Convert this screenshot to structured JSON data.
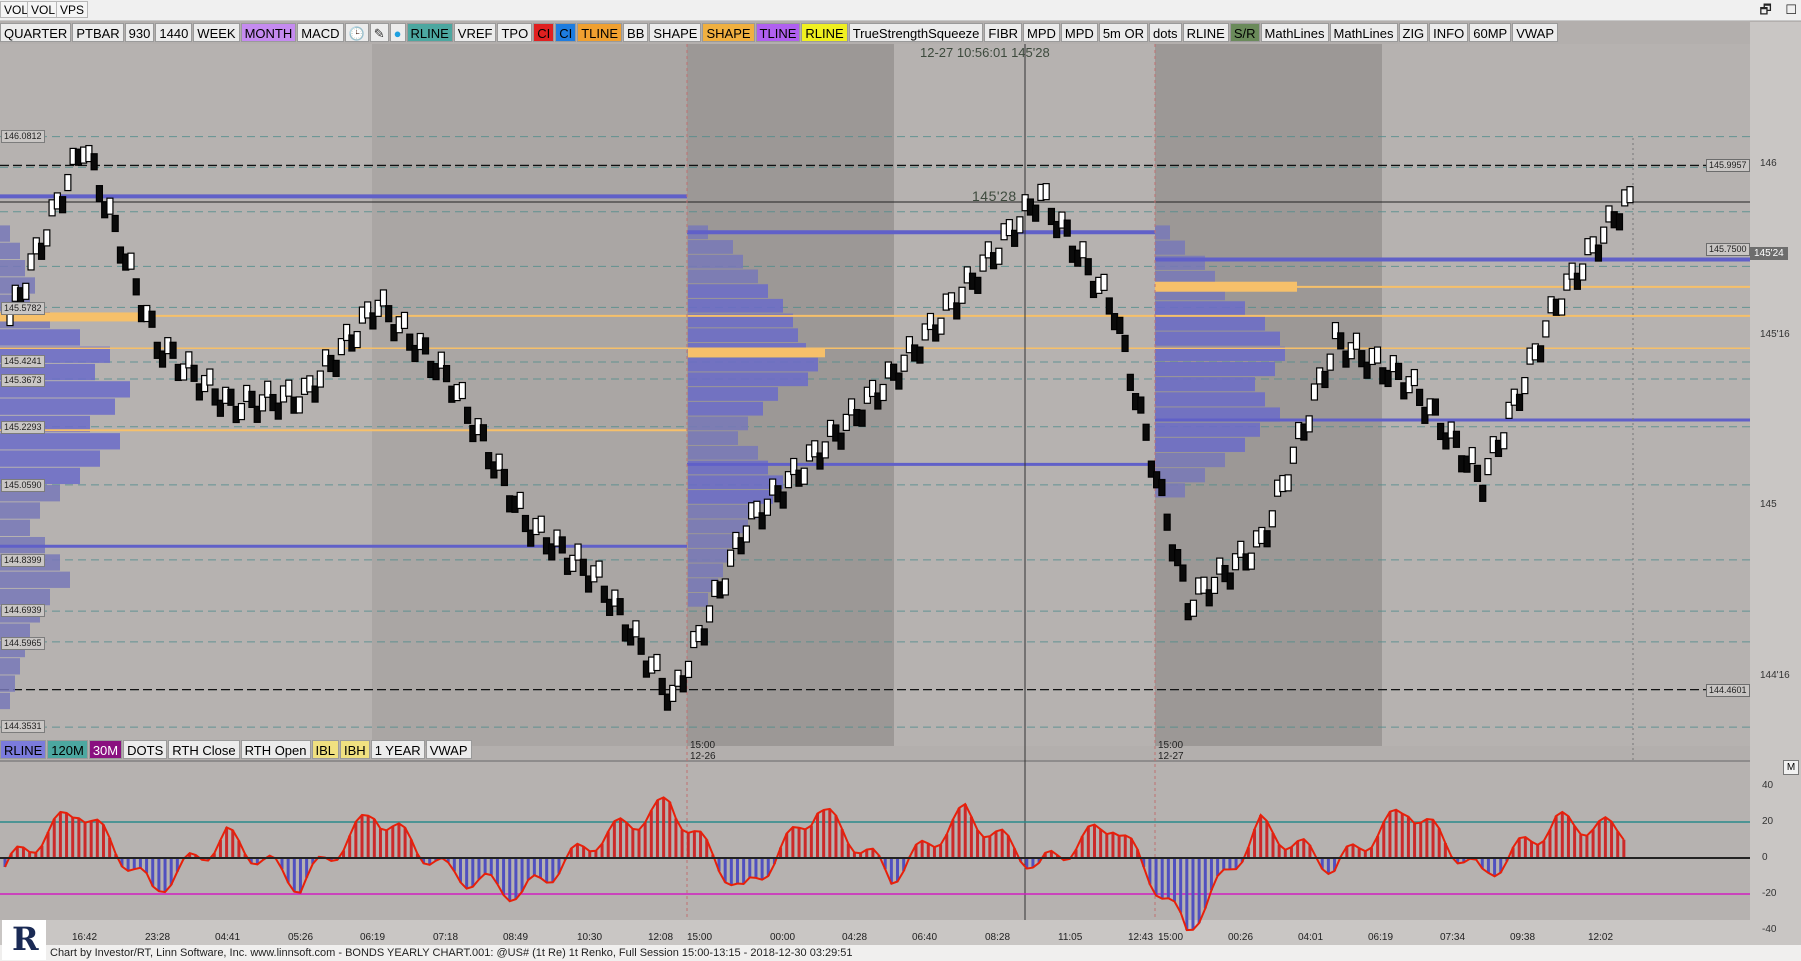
{
  "window_tabs": [
    "VOL",
    "VOL",
    "VPS"
  ],
  "window_controls": {
    "restore": "🗗",
    "close": "☐"
  },
  "toolbar": [
    {
      "label": "QUARTER",
      "bg": "#ececec",
      "fg": "#000000"
    },
    {
      "label": "PTBAR",
      "bg": "#ececec",
      "fg": "#000000"
    },
    {
      "label": "930",
      "bg": "#ececec",
      "fg": "#000000"
    },
    {
      "label": "1440",
      "bg": "#ececec",
      "fg": "#000000"
    },
    {
      "label": "WEEK",
      "bg": "#ececec",
      "fg": "#000000"
    },
    {
      "label": "MONTH",
      "bg": "#c58bf0",
      "fg": "#000000"
    },
    {
      "label": "MACD",
      "bg": "#ececec",
      "fg": "#000000"
    },
    {
      "label": "🕒",
      "bg": "#ececec",
      "fg": "#1e6bd8"
    },
    {
      "label": "✎",
      "bg": "#ececec",
      "fg": "#333333"
    },
    {
      "label": "●",
      "bg": "#ececec",
      "fg": "#1ea0e0"
    },
    {
      "label": "RLINE",
      "bg": "#4ca7a0",
      "fg": "#000000"
    },
    {
      "label": "VREF",
      "bg": "#ececec",
      "fg": "#000000"
    },
    {
      "label": "TPO",
      "bg": "#ececec",
      "fg": "#000000"
    },
    {
      "label": "CI",
      "bg": "#e02020",
      "fg": "#000000"
    },
    {
      "label": "CI",
      "bg": "#1e7de0",
      "fg": "#000000"
    },
    {
      "label": "TLINE",
      "bg": "#f0a030",
      "fg": "#000000"
    },
    {
      "label": "BB",
      "bg": "#ececec",
      "fg": "#000000"
    },
    {
      "label": "SHAPE",
      "bg": "#ececec",
      "fg": "#000000"
    },
    {
      "label": "SHAPE",
      "bg": "#f0b040",
      "fg": "#000000"
    },
    {
      "label": "TLINE",
      "bg": "#b060f0",
      "fg": "#000000"
    },
    {
      "label": "RLINE",
      "bg": "#f0f020",
      "fg": "#000000"
    },
    {
      "label": "TrueStrengthSqueeze",
      "bg": "#ececec",
      "fg": "#000000"
    },
    {
      "label": "FIBR",
      "bg": "#ececec",
      "fg": "#000000"
    },
    {
      "label": "MPD",
      "bg": "#ececec",
      "fg": "#000000"
    },
    {
      "label": "MPD",
      "bg": "#ececec",
      "fg": "#000000"
    },
    {
      "label": "5m OR",
      "bg": "#ececec",
      "fg": "#000000"
    },
    {
      "label": "dots",
      "bg": "#ececec",
      "fg": "#000000"
    },
    {
      "label": "RLINE",
      "bg": "#ececec",
      "fg": "#000000"
    },
    {
      "label": "S/R",
      "bg": "#6a8a5a",
      "fg": "#000000"
    },
    {
      "label": "MathLines",
      "bg": "#ececec",
      "fg": "#000000"
    },
    {
      "label": "MathLines",
      "bg": "#ececec",
      "fg": "#000000"
    },
    {
      "label": "ZIG",
      "bg": "#ececec",
      "fg": "#000000"
    },
    {
      "label": "INFO",
      "bg": "#ececec",
      "fg": "#000000"
    },
    {
      "label": "60MP",
      "bg": "#ececec",
      "fg": "#000000"
    },
    {
      "label": "VWAP",
      "bg": "#ececec",
      "fg": "#000000"
    }
  ],
  "bottom_toolbar": [
    {
      "label": "RLINE",
      "bg": "#7b7bdc",
      "fg": "#000000"
    },
    {
      "label": "120M",
      "bg": "#4ca7a0",
      "fg": "#000000"
    },
    {
      "label": "30M",
      "bg": "#8a1080",
      "fg": "#ffffff"
    },
    {
      "label": "DOTS",
      "bg": "#ececec",
      "fg": "#000000"
    },
    {
      "label": "RTH Close",
      "bg": "#ececec",
      "fg": "#000000"
    },
    {
      "label": "RTH Open",
      "bg": "#ececec",
      "fg": "#000000"
    },
    {
      "label": "IBL",
      "bg": "#f0e080",
      "fg": "#000000"
    },
    {
      "label": "IBH",
      "bg": "#f0e080",
      "fg": "#000000"
    },
    {
      "label": "1 YEAR",
      "bg": "#ececec",
      "fg": "#000000"
    },
    {
      "label": "VWAP",
      "bg": "#ececec",
      "fg": "#000000"
    }
  ],
  "timestamp": "12-27 10:56:01  145'28",
  "price_label": "145'28",
  "current_price": "145'24",
  "left_levels": [
    {
      "text": "146.0812",
      "price": 146.0812
    },
    {
      "text": "145.5782",
      "price": 145.5782
    },
    {
      "text": "145.4241",
      "price": 145.4241
    },
    {
      "text": "145.3673",
      "price": 145.3673
    },
    {
      "text": "145.2293",
      "price": 145.2293
    },
    {
      "text": "145.0590",
      "price": 145.059
    },
    {
      "text": "144.8399",
      "price": 144.8399
    },
    {
      "text": "144.6939",
      "price": 144.6939
    },
    {
      "text": "144.5965",
      "price": 144.5965
    },
    {
      "text": "144.3531",
      "price": 144.3531
    }
  ],
  "right_levels": [
    {
      "text": "145.9957",
      "price": 145.9957
    },
    {
      "text": "145.7500",
      "price": 145.75
    },
    {
      "text": "144.4601",
      "price": 144.4601
    }
  ],
  "price_axis": [
    {
      "text": "146",
      "price": 146.0
    },
    {
      "text": "145'16",
      "price": 145.5
    },
    {
      "text": "145",
      "price": 145.0
    },
    {
      "text": "144'16",
      "price": 144.5
    }
  ],
  "day_labels": [
    {
      "time": "15:00",
      "date": "12-26"
    },
    {
      "time": "15:00",
      "date": "12-27"
    }
  ],
  "time_axis": [
    "16:42",
    "23:28",
    "04:41",
    "05:26",
    "06:19",
    "07:18",
    "08:49",
    "10:30",
    "12:08",
    "15:00",
    "00:00",
    "04:28",
    "06:40",
    "08:28",
    "11:05",
    "12:43",
    "15:00",
    "00:26",
    "04:01",
    "06:19",
    "07:34",
    "09:38",
    "12:02"
  ],
  "osc_axis": [
    "40",
    "20",
    "0",
    "-20",
    "-40"
  ],
  "footer": "Chart by Investor/RT, Linn Software, Inc. www.linnsoft.com - BONDS YEARLY CHART.001: @US# (1t Re) 1t Renko, Full Session 15:00-13:15 - 2018-12-30 03:29:51",
  "logo_text": "R",
  "osc_panel_button": "M",
  "chart_data": {
    "type": "line",
    "instrument": "@US#",
    "y_axis_range": [
      144.33,
      146.12
    ],
    "price_path_x": [
      "16:42",
      "23:28",
      "04:41",
      "05:26",
      "06:19",
      "07:18",
      "08:49",
      "10:30",
      "12:08",
      "15:00",
      "00:00",
      "04:28",
      "06:40",
      "08:28",
      "11:05",
      "12:43",
      "15:00",
      "00:26",
      "04:01",
      "06:19",
      "07:34",
      "09:38",
      "12:02"
    ],
    "price_path": [
      145.55,
      146.06,
      145.47,
      145.29,
      145.32,
      145.59,
      145.36,
      144.95,
      144.78,
      144.43,
      144.94,
      145.16,
      145.38,
      145.64,
      145.91,
      145.57,
      144.71,
      144.89,
      145.48,
      145.36,
      145.07,
      145.59,
      145.91
    ],
    "osc_path": [
      -5,
      28,
      -18,
      12,
      -15,
      25,
      -8,
      -20,
      10,
      30,
      -20,
      28,
      -10,
      25,
      -5,
      20,
      -40,
      18,
      -5,
      28,
      -10,
      20,
      15
    ]
  }
}
